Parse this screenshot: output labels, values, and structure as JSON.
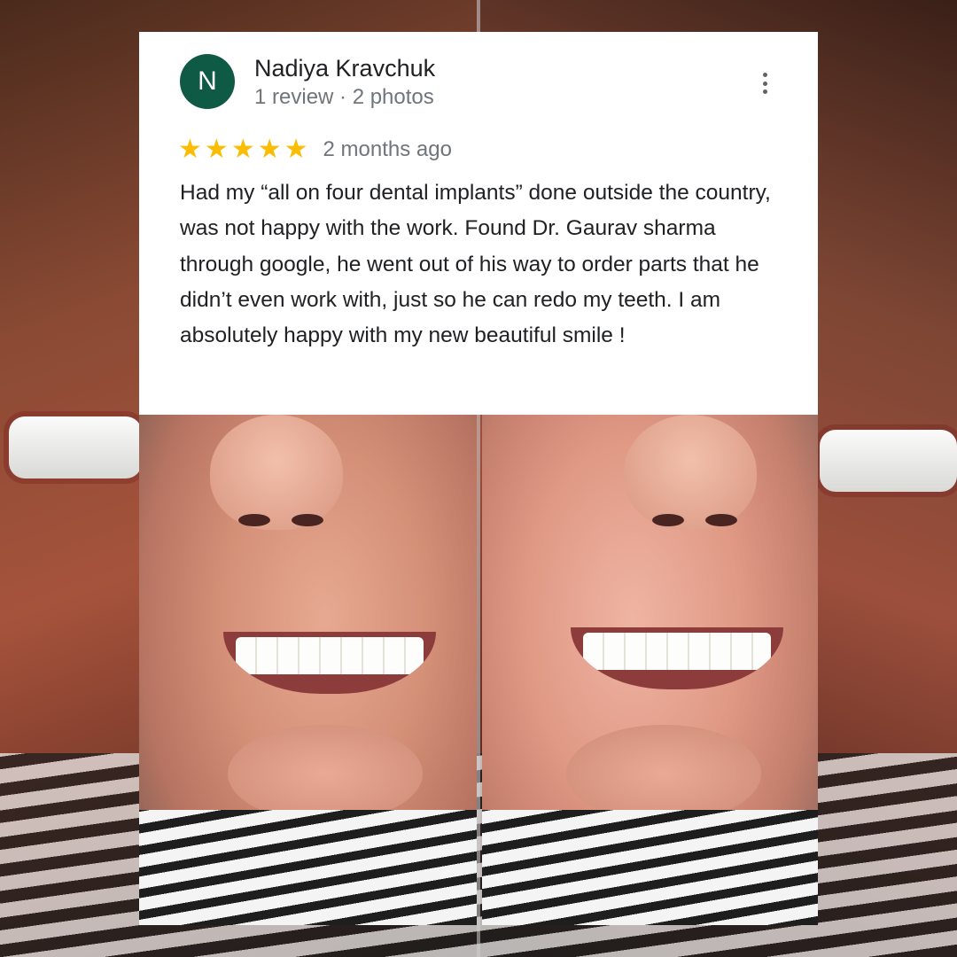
{
  "review": {
    "reviewer_initial": "N",
    "reviewer_name": "Nadiya Kravchuk",
    "reviewer_meta": "1 review · 2 photos",
    "rating": 5,
    "stars": [
      "★",
      "★",
      "★",
      "★",
      "★"
    ],
    "time_ago": "2 months ago",
    "text": "Had my “all on four dental implants” done outside the country, was not happy with the work. Found Dr. Gaurav sharma through google, he went out of his way to order parts that he didn’t even work with, just so he can redo my teeth.  I am absolutely happy with my new beautiful smile !",
    "more_icon": "more-vert-icon"
  },
  "colors": {
    "avatar": "#0f5a45",
    "star": "#fbbc04",
    "primary_text": "#202124",
    "secondary_text": "#70757a"
  },
  "photos": [
    {
      "icon": "before-smile-photo"
    },
    {
      "icon": "after-smile-photo"
    }
  ]
}
